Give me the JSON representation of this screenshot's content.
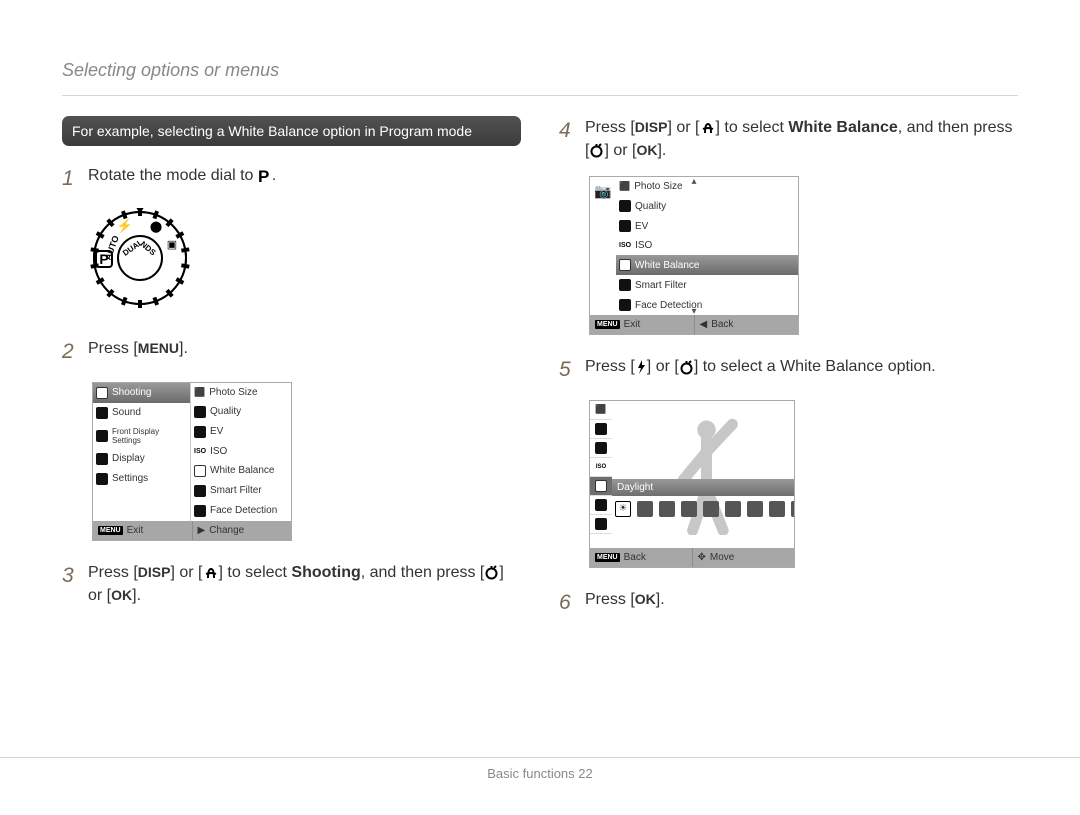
{
  "header": "Selecting options or menus",
  "callout": "For example, selecting a White Balance option in Program mode",
  "steps": {
    "s1_a": "Rotate the mode dial to ",
    "s1_b": ".",
    "s2_a": "Press [",
    "s2_b": "].",
    "s2_menu": "MENU",
    "s3_a": "Press [",
    "s3_disp": "DISP",
    "s3_b": "] or [",
    "s3_c": "] to select ",
    "s3_shoot": "Shooting",
    "s3_d": ", and then press [",
    "s3_e": "] or [",
    "s3_ok": "OK",
    "s3_f": "].",
    "s4_a": "Press [",
    "s4_b": "] or [",
    "s4_c": "] to select ",
    "s4_wb": "White Balance",
    "s4_d": ", and then press [",
    "s4_e": "] or [",
    "s4_f": "].",
    "s5_a": "Press [",
    "s5_b": "] or [",
    "s5_c": "] to select a White Balance option.",
    "s6_a": "Press [",
    "s6_b": "]."
  },
  "lcd_menu": {
    "sidebar": [
      "Shooting",
      "Sound",
      "Front Display Settings",
      "Display",
      "Settings"
    ],
    "list": [
      "Photo Size",
      "Quality",
      "EV",
      "ISO",
      "White Balance",
      "Smart Filter",
      "Face Detection"
    ],
    "bar_left_label": "Exit",
    "bar_right_label": "Change"
  },
  "lcd_wb_list": {
    "list": [
      "Photo Size",
      "Quality",
      "EV",
      "ISO",
      "White Balance",
      "Smart Filter",
      "Face Detection"
    ],
    "selected_index": 4,
    "bar_left_label": "Exit",
    "bar_right_label": "Back"
  },
  "lcd_wb_preview": {
    "selected_label": "Daylight",
    "bar_left_label": "Back",
    "bar_right_label": "Move"
  },
  "footer_a": "Basic functions  ",
  "footer_page": "22"
}
